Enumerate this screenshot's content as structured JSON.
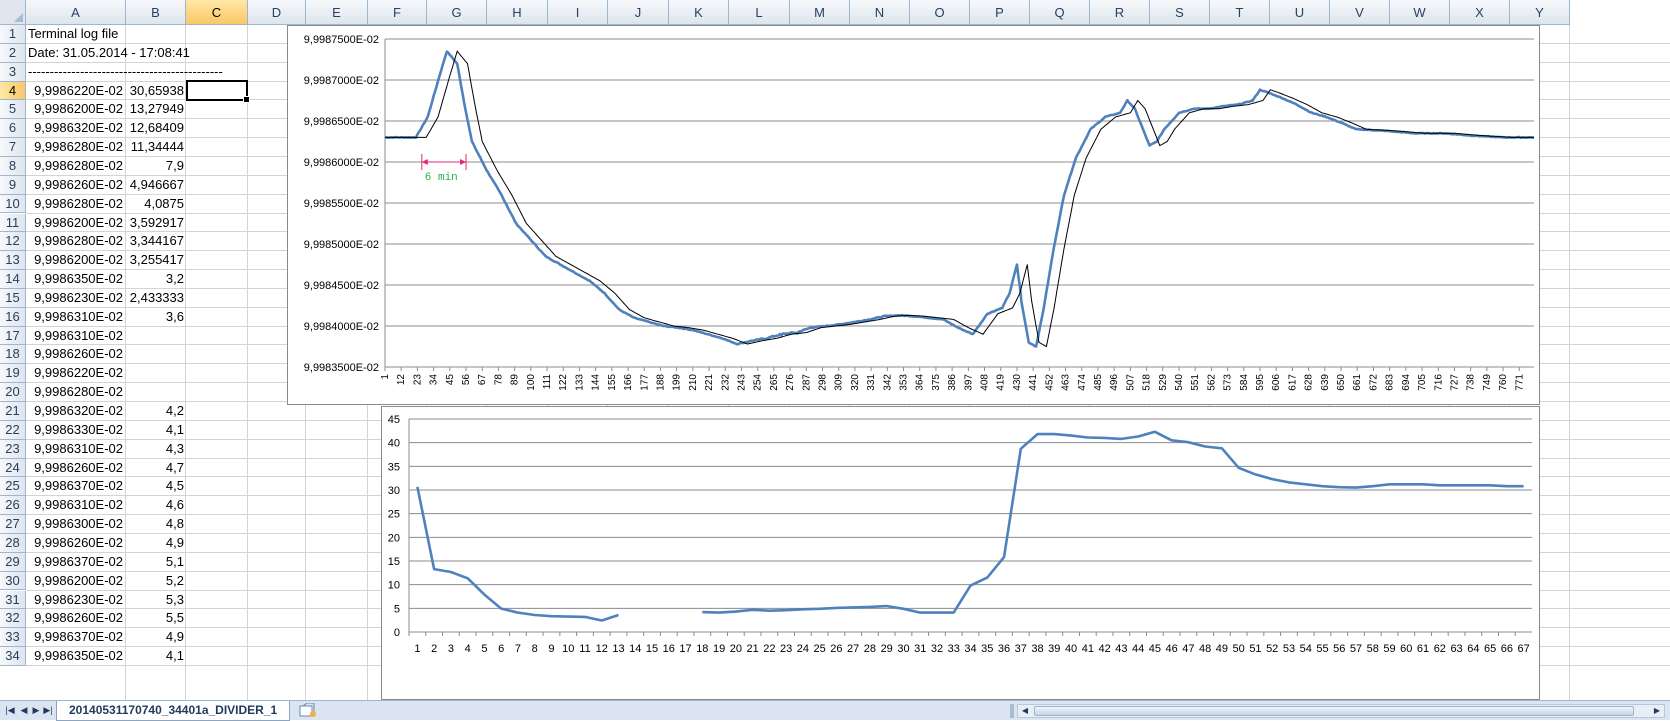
{
  "columns": [
    "A",
    "B",
    "C",
    "D",
    "E",
    "F",
    "G",
    "H",
    "I",
    "J",
    "K",
    "L",
    "M",
    "N",
    "O",
    "P",
    "Q",
    "R",
    "S",
    "T",
    "U",
    "V",
    "W",
    "X",
    "Y"
  ],
  "selected_column": "C",
  "selected_row": "4",
  "rows": [
    {
      "n": "1",
      "a": "Terminal log file",
      "b": ""
    },
    {
      "n": "2",
      "a": "Date: 31.05.2014 - 17:08:41",
      "b": ""
    },
    {
      "n": "3",
      "a": "---------------------------------------------",
      "b": ""
    },
    {
      "n": "4",
      "a": "9,9986220E-02",
      "b": "30,65938"
    },
    {
      "n": "5",
      "a": "9,9986200E-02",
      "b": "13,27949"
    },
    {
      "n": "6",
      "a": "9,9986320E-02",
      "b": "12,68409"
    },
    {
      "n": "7",
      "a": "9,9986280E-02",
      "b": "11,34444"
    },
    {
      "n": "8",
      "a": "9,9986280E-02",
      "b": "7,9"
    },
    {
      "n": "9",
      "a": "9,9986260E-02",
      "b": "4,946667"
    },
    {
      "n": "10",
      "a": "9,9986280E-02",
      "b": "4,0875"
    },
    {
      "n": "11",
      "a": "9,9986200E-02",
      "b": "3,592917"
    },
    {
      "n": "12",
      "a": "9,9986280E-02",
      "b": "3,344167"
    },
    {
      "n": "13",
      "a": "9,9986200E-02",
      "b": "3,255417"
    },
    {
      "n": "14",
      "a": "9,9986350E-02",
      "b": "3,2"
    },
    {
      "n": "15",
      "a": "9,9986230E-02",
      "b": "2,433333"
    },
    {
      "n": "16",
      "a": "9,9986310E-02",
      "b": "3,6"
    },
    {
      "n": "17",
      "a": "9,9986310E-02",
      "b": ""
    },
    {
      "n": "18",
      "a": "9,9986260E-02",
      "b": ""
    },
    {
      "n": "19",
      "a": "9,9986220E-02",
      "b": ""
    },
    {
      "n": "20",
      "a": "9,9986280E-02",
      "b": ""
    },
    {
      "n": "21",
      "a": "9,9986320E-02",
      "b": "4,2"
    },
    {
      "n": "22",
      "a": "9,9986330E-02",
      "b": "4,1"
    },
    {
      "n": "23",
      "a": "9,9986310E-02",
      "b": "4,3"
    },
    {
      "n": "24",
      "a": "9,9986260E-02",
      "b": "4,7"
    },
    {
      "n": "25",
      "a": "9,9986370E-02",
      "b": "4,5"
    },
    {
      "n": "26",
      "a": "9,9986310E-02",
      "b": "4,6"
    },
    {
      "n": "27",
      "a": "9,9986300E-02",
      "b": "4,8"
    },
    {
      "n": "28",
      "a": "9,9986260E-02",
      "b": "4,9"
    },
    {
      "n": "29",
      "a": "9,9986370E-02",
      "b": "5,1"
    },
    {
      "n": "30",
      "a": "9,9986200E-02",
      "b": "5,2"
    },
    {
      "n": "31",
      "a": "9,9986230E-02",
      "b": "5,3"
    },
    {
      "n": "32",
      "a": "9,9986260E-02",
      "b": "5,5"
    },
    {
      "n": "33",
      "a": "9,9986370E-02",
      "b": "4,9"
    },
    {
      "n": "34",
      "a": "9,9986350E-02",
      "b": "4,1"
    }
  ],
  "sheet_tab": "20140531170740_34401a_DIVIDER_1",
  "chart_data": [
    {
      "type": "line",
      "ylim": [
        0.0999835,
        0.0999875
      ],
      "y_ticks": [
        "9,9983500E-02",
        "9,9984000E-02",
        "9,9984500E-02",
        "9,9985000E-02",
        "9,9985500E-02",
        "9,9986000E-02",
        "9,9986500E-02",
        "9,9987000E-02",
        "9,9987500E-02"
      ],
      "x_ticks": [
        "1",
        "12",
        "23",
        "34",
        "45",
        "56",
        "67",
        "78",
        "89",
        "100",
        "111",
        "122",
        "133",
        "144",
        "155",
        "166",
        "177",
        "188",
        "199",
        "210",
        "221",
        "232",
        "243",
        "254",
        "265",
        "276",
        "287",
        "298",
        "309",
        "320",
        "331",
        "342",
        "353",
        "364",
        "375",
        "386",
        "397",
        "408",
        "419",
        "430",
        "441",
        "452",
        "463",
        "474",
        "485",
        "496",
        "507",
        "518",
        "529",
        "540",
        "551",
        "562",
        "573",
        "584",
        "595",
        "606",
        "617",
        "628",
        "639",
        "650",
        "661",
        "672",
        "683",
        "694",
        "705",
        "716",
        "727",
        "738",
        "749",
        "760",
        "771"
      ],
      "xlim": [
        1,
        781
      ],
      "series_colors": [
        "#4f81bd",
        "#000000"
      ],
      "keypoints_x": [
        1,
        22,
        30,
        38,
        43,
        50,
        55,
        60,
        70,
        80,
        90,
        100,
        110,
        120,
        130,
        140,
        150,
        160,
        170,
        180,
        190,
        200,
        210,
        220,
        230,
        240,
        250,
        260,
        270,
        280,
        290,
        300,
        310,
        320,
        330,
        340,
        350,
        360,
        370,
        380,
        390,
        400,
        410,
        420,
        425,
        430,
        433,
        438,
        443,
        448,
        455,
        462,
        470,
        480,
        490,
        500,
        505,
        510,
        520,
        525,
        530,
        540,
        550,
        560,
        570,
        580,
        590,
        595,
        600,
        610,
        620,
        630,
        640,
        650,
        660,
        680,
        700,
        720,
        740,
        760,
        781
      ],
      "keypoints_y": [
        0.0999863,
        0.0999863,
        0.09998655,
        0.09998705,
        0.09998735,
        0.0999872,
        0.0999867,
        0.09998625,
        0.0999859,
        0.0999856,
        0.09998525,
        0.09998505,
        0.09998485,
        0.09998475,
        0.09998465,
        0.09998455,
        0.0999844,
        0.0999842,
        0.0999841,
        0.09998405,
        0.099984,
        0.09998398,
        0.09998395,
        0.0999839,
        0.09998385,
        0.09998378,
        0.09998382,
        0.09998385,
        0.0999839,
        0.09998392,
        0.09998398,
        0.099984,
        0.09998402,
        0.09998405,
        0.09998408,
        0.09998412,
        0.09998413,
        0.09998412,
        0.0999841,
        0.09998408,
        0.09998398,
        0.0999839,
        0.09998415,
        0.09998422,
        0.0999844,
        0.09998475,
        0.0999843,
        0.0999838,
        0.09998375,
        0.0999842,
        0.09998495,
        0.0999856,
        0.09998605,
        0.0999864,
        0.09998655,
        0.0999866,
        0.09998675,
        0.09998665,
        0.0999862,
        0.09998625,
        0.0999864,
        0.0999866,
        0.09998665,
        0.09998665,
        0.09998668,
        0.0999867,
        0.09998675,
        0.09998688,
        0.09998685,
        0.09998678,
        0.0999867,
        0.0999866,
        0.09998655,
        0.09998648,
        0.0999864,
        0.09998638,
        0.09998635,
        0.09998635,
        0.09998632,
        0.0999863,
        0.0999863
      ],
      "annotation": "6 min"
    },
    {
      "type": "line",
      "ylim": [
        0,
        45
      ],
      "y_ticks": [
        "0",
        "5",
        "10",
        "15",
        "20",
        "25",
        "30",
        "35",
        "40",
        "45"
      ],
      "categories": [
        "1",
        "2",
        "3",
        "4",
        "5",
        "6",
        "7",
        "8",
        "9",
        "10",
        "11",
        "12",
        "13",
        "14",
        "15",
        "16",
        "17",
        "18",
        "19",
        "20",
        "21",
        "22",
        "23",
        "24",
        "25",
        "26",
        "27",
        "28",
        "29",
        "30",
        "31",
        "32",
        "33",
        "34",
        "35",
        "36",
        "37",
        "38",
        "39",
        "40",
        "41",
        "42",
        "43",
        "44",
        "45",
        "46",
        "47",
        "48",
        "49",
        "50",
        "51",
        "52",
        "53",
        "54",
        "55",
        "56",
        "57",
        "58",
        "59",
        "60",
        "61",
        "62",
        "63",
        "64",
        "65",
        "66",
        "67"
      ],
      "values": [
        30.66,
        13.28,
        12.68,
        11.34,
        7.9,
        4.95,
        4.09,
        3.59,
        3.34,
        3.26,
        3.2,
        2.43,
        3.6,
        null,
        null,
        null,
        null,
        4.2,
        4.1,
        4.3,
        4.7,
        4.5,
        4.6,
        4.8,
        4.9,
        5.1,
        5.2,
        5.3,
        5.5,
        4.9,
        4.1,
        4.1,
        4.1,
        9.8,
        11.5,
        15.8,
        38.7,
        41.8,
        41.8,
        41.5,
        41.1,
        41.0,
        40.8,
        41.3,
        42.3,
        40.5,
        40.1,
        39.2,
        38.8,
        34.7,
        33.3,
        32.3,
        31.6,
        31.2,
        30.8,
        30.6,
        30.5,
        30.8,
        31.2,
        31.2,
        31.2,
        31.0,
        31.0,
        31.0,
        31.0,
        30.8,
        30.8
      ],
      "series_colors": [
        "#4f81bd"
      ]
    }
  ]
}
